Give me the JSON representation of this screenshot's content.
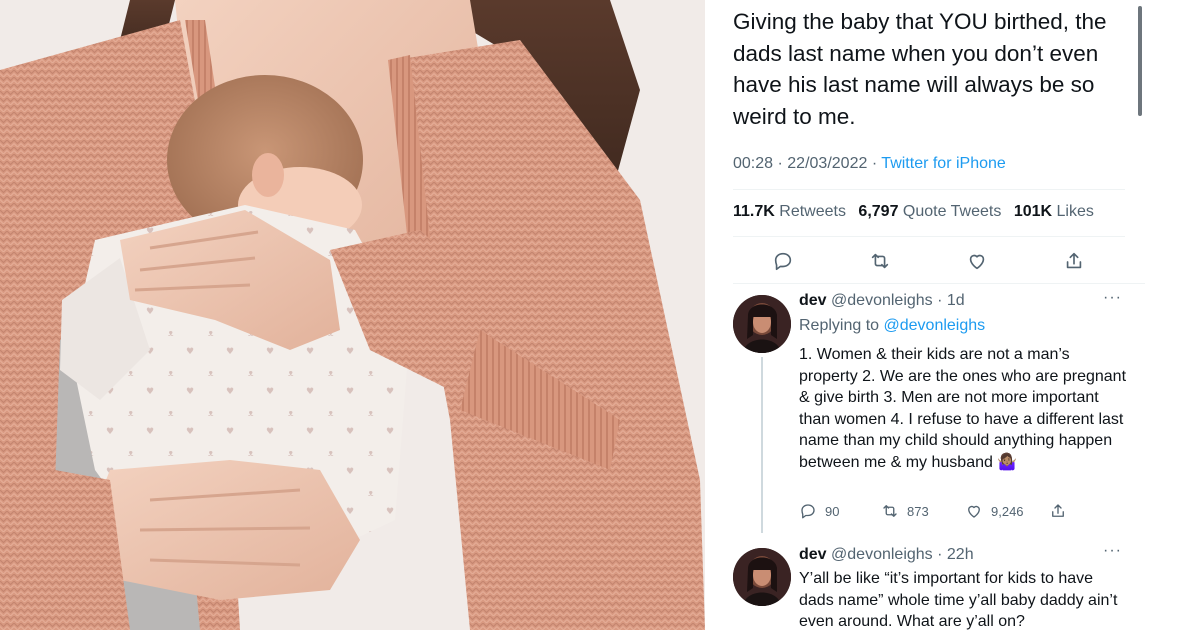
{
  "tweet": {
    "text": "Giving the baby that YOU birthed, the dads last name when you don’t even have his last name will always be so weird to me.",
    "time": "00:28",
    "separator": "·",
    "date": "22/03/2022",
    "source": "Twitter for iPhone",
    "stats": {
      "retweets_count": "11.7K",
      "retweets_label": "Retweets",
      "quotes_count": "6,797",
      "quotes_label": "Quote Tweets",
      "likes_count": "101K",
      "likes_label": "Likes"
    },
    "actions": [
      "reply-icon",
      "retweet-icon",
      "like-icon",
      "share-icon"
    ]
  },
  "replies": [
    {
      "name": "dev",
      "handle": "@devonleighs",
      "separator": "·",
      "age": "1d",
      "more": "···",
      "replying_label": "Replying to",
      "replying_handle": "@devonleighs",
      "text": "1. Women & their kids are not a man’s property 2. We are the ones who are pregnant & give birth 3. Men are not more important than women 4. I refuse to have a different last name than my child should anything happen between me & my husband 🤷🏽‍♀️",
      "reply_count": "90",
      "retweet_count": "873",
      "like_count": "9,246"
    },
    {
      "name": "dev",
      "handle": "@devonleighs",
      "separator": "·",
      "age": "22h",
      "more": "···",
      "text": "Y’all be like “it’s important for kids to have dads name” whole time y’all baby daddy ain’t even around. What are y’all on?"
    }
  ],
  "colors": {
    "text": "#0f1419",
    "secondary": "#536471",
    "link": "#1d9bf0",
    "divider": "#eff3f4",
    "cardigan": "#d99a82"
  }
}
